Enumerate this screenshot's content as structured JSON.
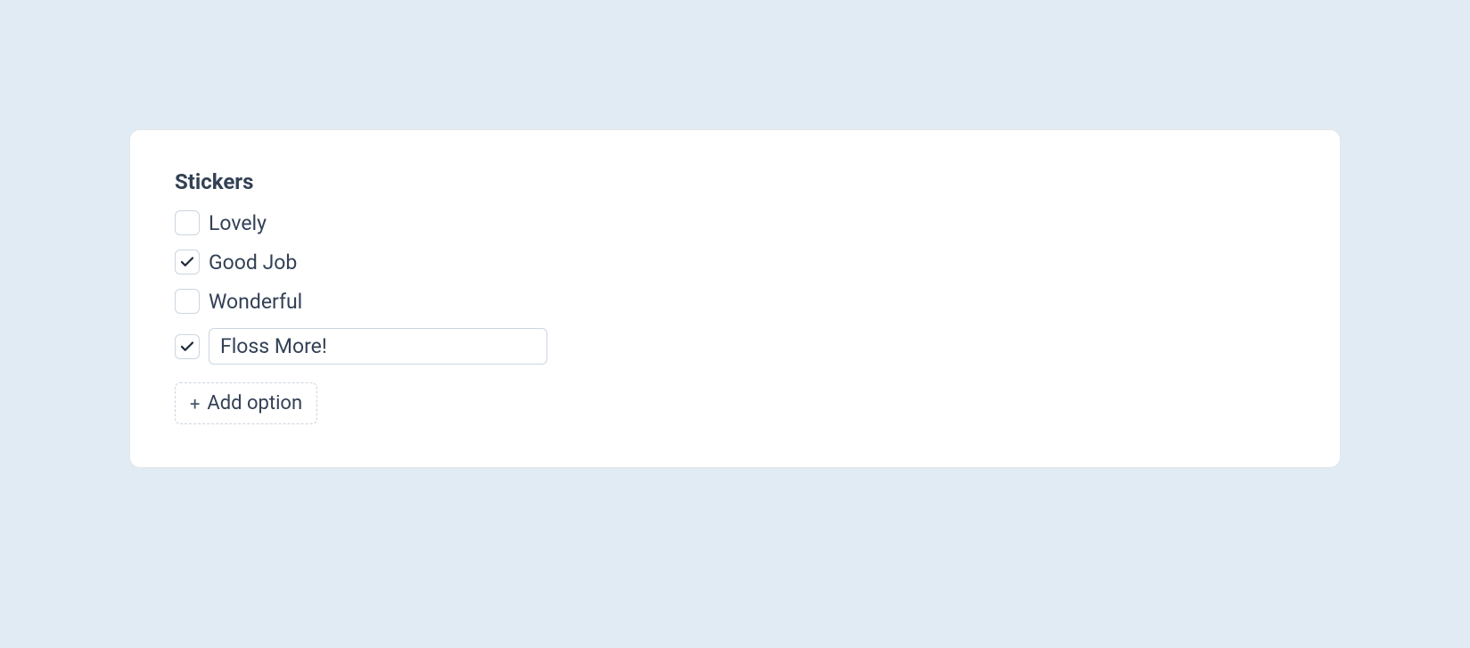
{
  "section": {
    "title": "Stickers",
    "options": [
      {
        "label": "Lovely",
        "checked": false,
        "editable": false
      },
      {
        "label": "Good Job",
        "checked": true,
        "editable": false
      },
      {
        "label": "Wonderful",
        "checked": false,
        "editable": false
      },
      {
        "label": "Floss More!",
        "checked": true,
        "editable": true
      }
    ],
    "addButton": {
      "label": "Add option"
    }
  }
}
